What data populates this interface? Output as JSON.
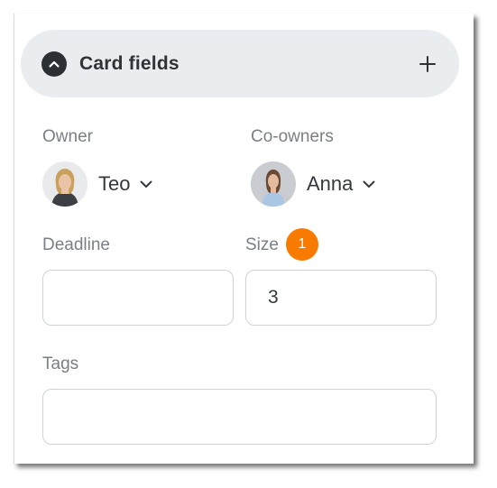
{
  "header": {
    "title": "Card fields",
    "toggle_icon": "chevron-up-icon",
    "add_icon": "plus-icon"
  },
  "owner": {
    "label": "Owner",
    "name": "Teo"
  },
  "coowners": {
    "label": "Co-owners",
    "name": "Anna"
  },
  "deadline": {
    "label": "Deadline",
    "value": ""
  },
  "size": {
    "label": "Size",
    "value": "3",
    "badge": "1"
  },
  "tags": {
    "label": "Tags",
    "value": ""
  },
  "colors": {
    "header_bg": "#eaedf0",
    "badge": "#f97a00",
    "text_dark": "#34383c",
    "text_muted": "#7a7f85"
  }
}
